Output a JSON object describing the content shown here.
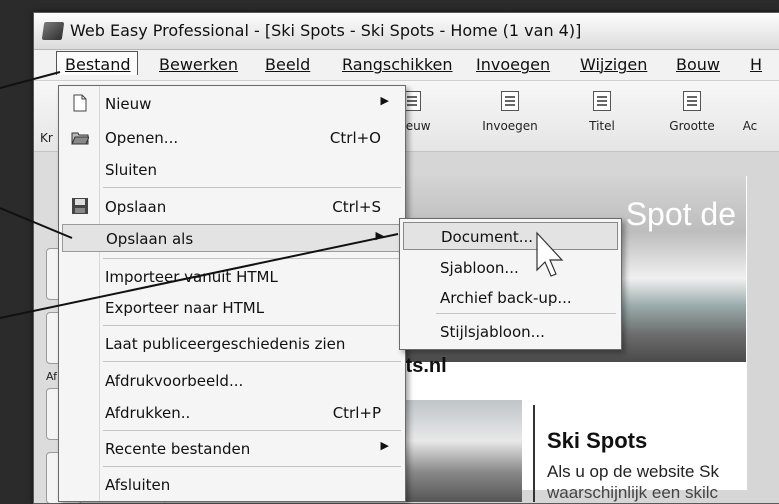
{
  "window": {
    "title": "Web Easy Professional - [Ski Spots - Ski Spots - Home (1 van 4)]"
  },
  "menubar": {
    "items": [
      "Bestand",
      "Bewerken",
      "Beeld",
      "Rangschikken",
      "Invoegen",
      "Wijzigen",
      "Bouw",
      "H"
    ]
  },
  "toolbar": {
    "buttons": [
      "Kr",
      "Nieuw",
      "Invoegen",
      "Titel",
      "Grootte",
      "Ac"
    ]
  },
  "left_panel": {
    "label": "Af"
  },
  "file_menu": {
    "items": [
      {
        "label": "Nieuw",
        "shortcut": ""
      },
      {
        "label": "Openen...",
        "shortcut": "Ctrl+O"
      },
      {
        "label": "Sluiten",
        "shortcut": ""
      },
      {
        "label": "Opslaan",
        "shortcut": "Ctrl+S"
      },
      {
        "label": "Opslaan als",
        "shortcut": ""
      },
      {
        "label": "Importeer vanuit HTML",
        "shortcut": ""
      },
      {
        "label": "Exporteer naar HTML",
        "shortcut": ""
      },
      {
        "label": "Laat publiceergeschiedenis zien",
        "shortcut": ""
      },
      {
        "label": "Afdrukvoorbeeld...",
        "shortcut": ""
      },
      {
        "label": "Afdrukken..",
        "shortcut": "Ctrl+P"
      },
      {
        "label": "Recente bestanden",
        "shortcut": ""
      },
      {
        "label": "Afsluiten",
        "shortcut": ""
      }
    ]
  },
  "submenu": {
    "items": [
      "Document...",
      "Sjabloon...",
      "Archief back-up...",
      "Stijlsjabloon..."
    ]
  },
  "page": {
    "banner_text": "Spot de",
    "url_text": "spots.nl",
    "heading": "Ski Spots",
    "body_line1": "Als u op de website Sk",
    "body_line2": "waarschijnlijk een skilc"
  }
}
